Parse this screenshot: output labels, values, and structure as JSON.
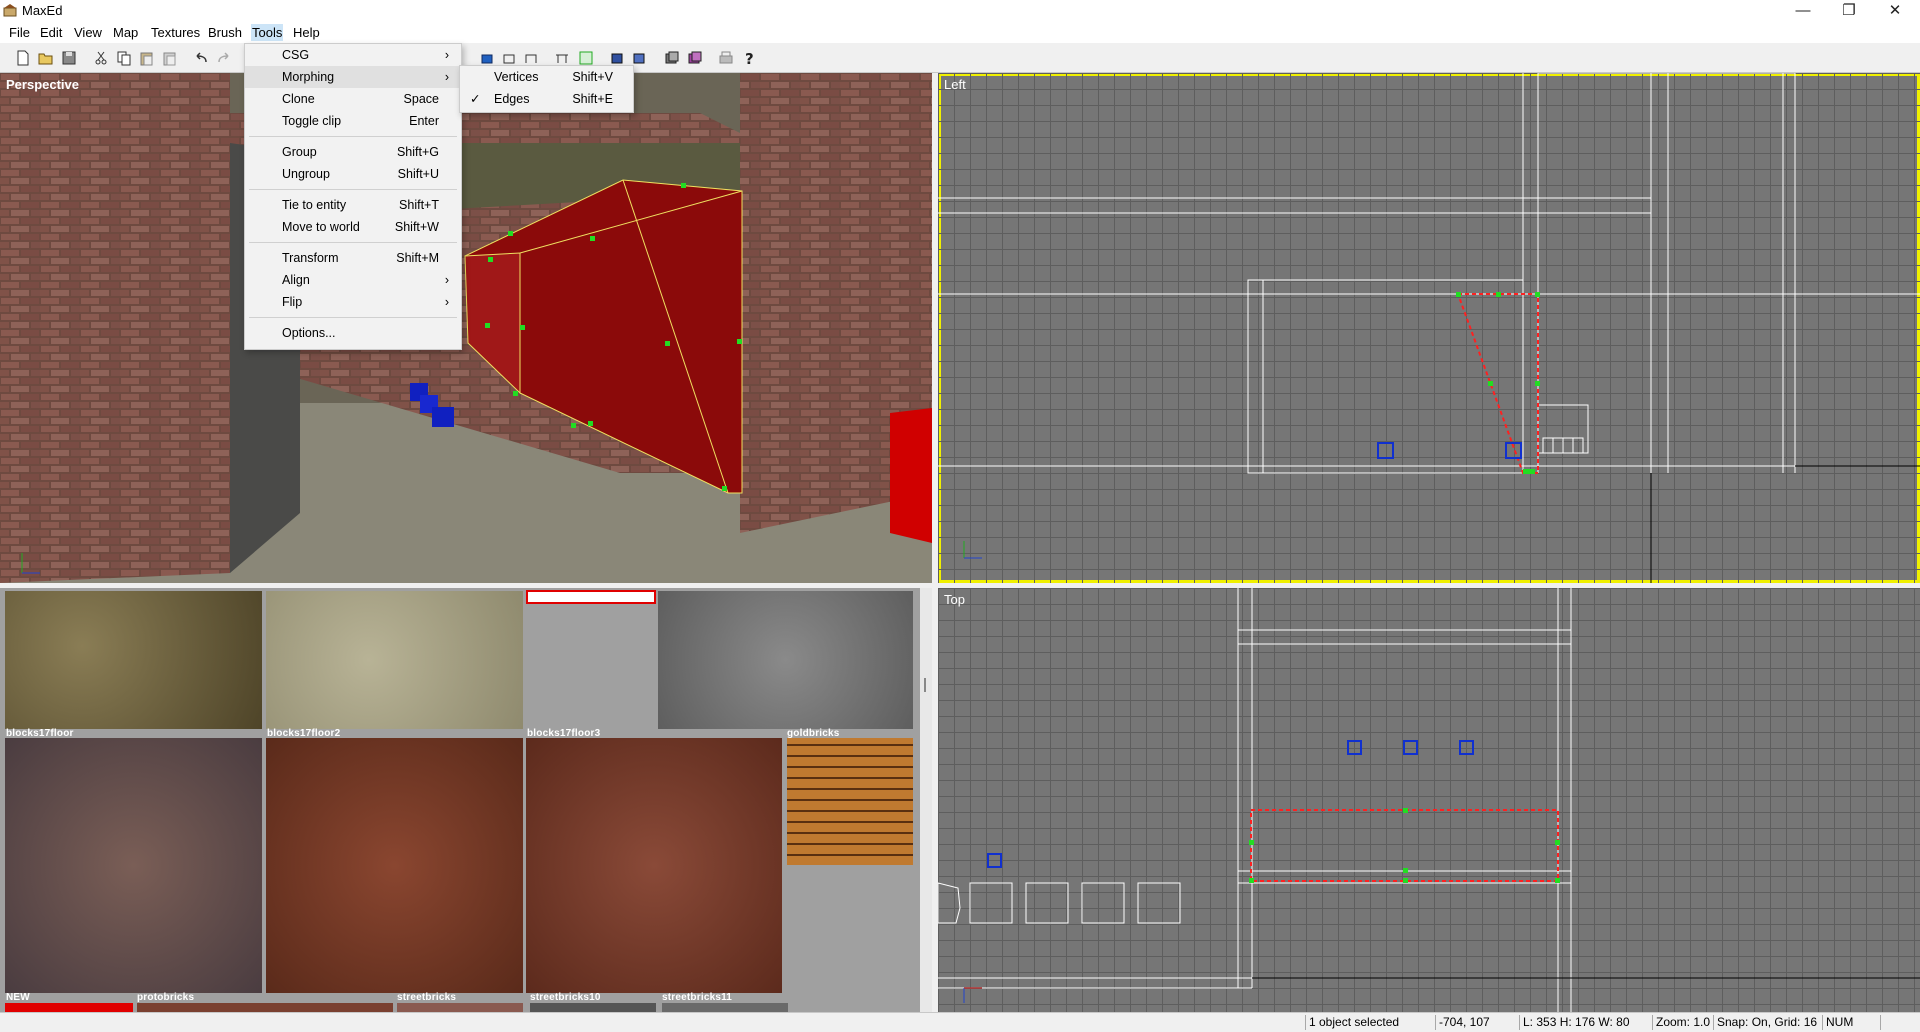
{
  "window": {
    "title": "MaxEd",
    "minimize": "—",
    "maximize": "❐",
    "close": "✕"
  },
  "menubar": [
    "File",
    "Edit",
    "View",
    "Map",
    "Textures",
    "Brush",
    "Tools",
    "Help"
  ],
  "tools_menu": [
    {
      "label": "CSG",
      "shortcut": "",
      "submenu": true
    },
    {
      "label": "Morphing",
      "shortcut": "",
      "submenu": true,
      "highlighted": true
    },
    {
      "label": "Clone",
      "shortcut": "Space"
    },
    {
      "label": "Toggle clip",
      "shortcut": "Enter"
    },
    {
      "label": "Group",
      "shortcut": "Shift+G"
    },
    {
      "label": "Ungroup",
      "shortcut": "Shift+U"
    },
    {
      "label": "Tie to entity",
      "shortcut": "Shift+T"
    },
    {
      "label": "Move to world",
      "shortcut": "Shift+W"
    },
    {
      "label": "Transform",
      "shortcut": "Shift+M"
    },
    {
      "label": "Align",
      "shortcut": "",
      "submenu": true
    },
    {
      "label": "Flip",
      "shortcut": "",
      "submenu": true
    },
    {
      "label": "Options...",
      "shortcut": ""
    }
  ],
  "morphing_submenu": [
    {
      "label": "Vertices",
      "shortcut": "Shift+V",
      "checked": false
    },
    {
      "label": "Edges",
      "shortcut": "Shift+E",
      "checked": true
    }
  ],
  "viewports": {
    "perspective": "Perspective",
    "left": "Left",
    "top": "Top"
  },
  "textures": [
    "blocks17floor",
    "blocks17floor2",
    "blocks17floor3",
    "goldbricks",
    "NEW",
    "protobricks",
    "streetbricks",
    "streetbricks10",
    "streetbricks11"
  ],
  "status": {
    "selection": "1 object selected",
    "coords": "-704, 107",
    "dims": "L: 353 H: 176 W: 80",
    "zoom": "Zoom: 1.0",
    "snap": "Snap: On, Grid: 16",
    "num": "NUM"
  },
  "colors": {
    "selection_yellow": "#f0f000",
    "brush_red": "#8b0a0a",
    "vertex_green": "#22dd22"
  },
  "icons": [
    "new-icon",
    "open-icon",
    "save-icon",
    "cut-icon",
    "copy-icon",
    "paste-icon",
    "paste-special-icon",
    "undo-icon",
    "redo-icon",
    "help-icon"
  ]
}
